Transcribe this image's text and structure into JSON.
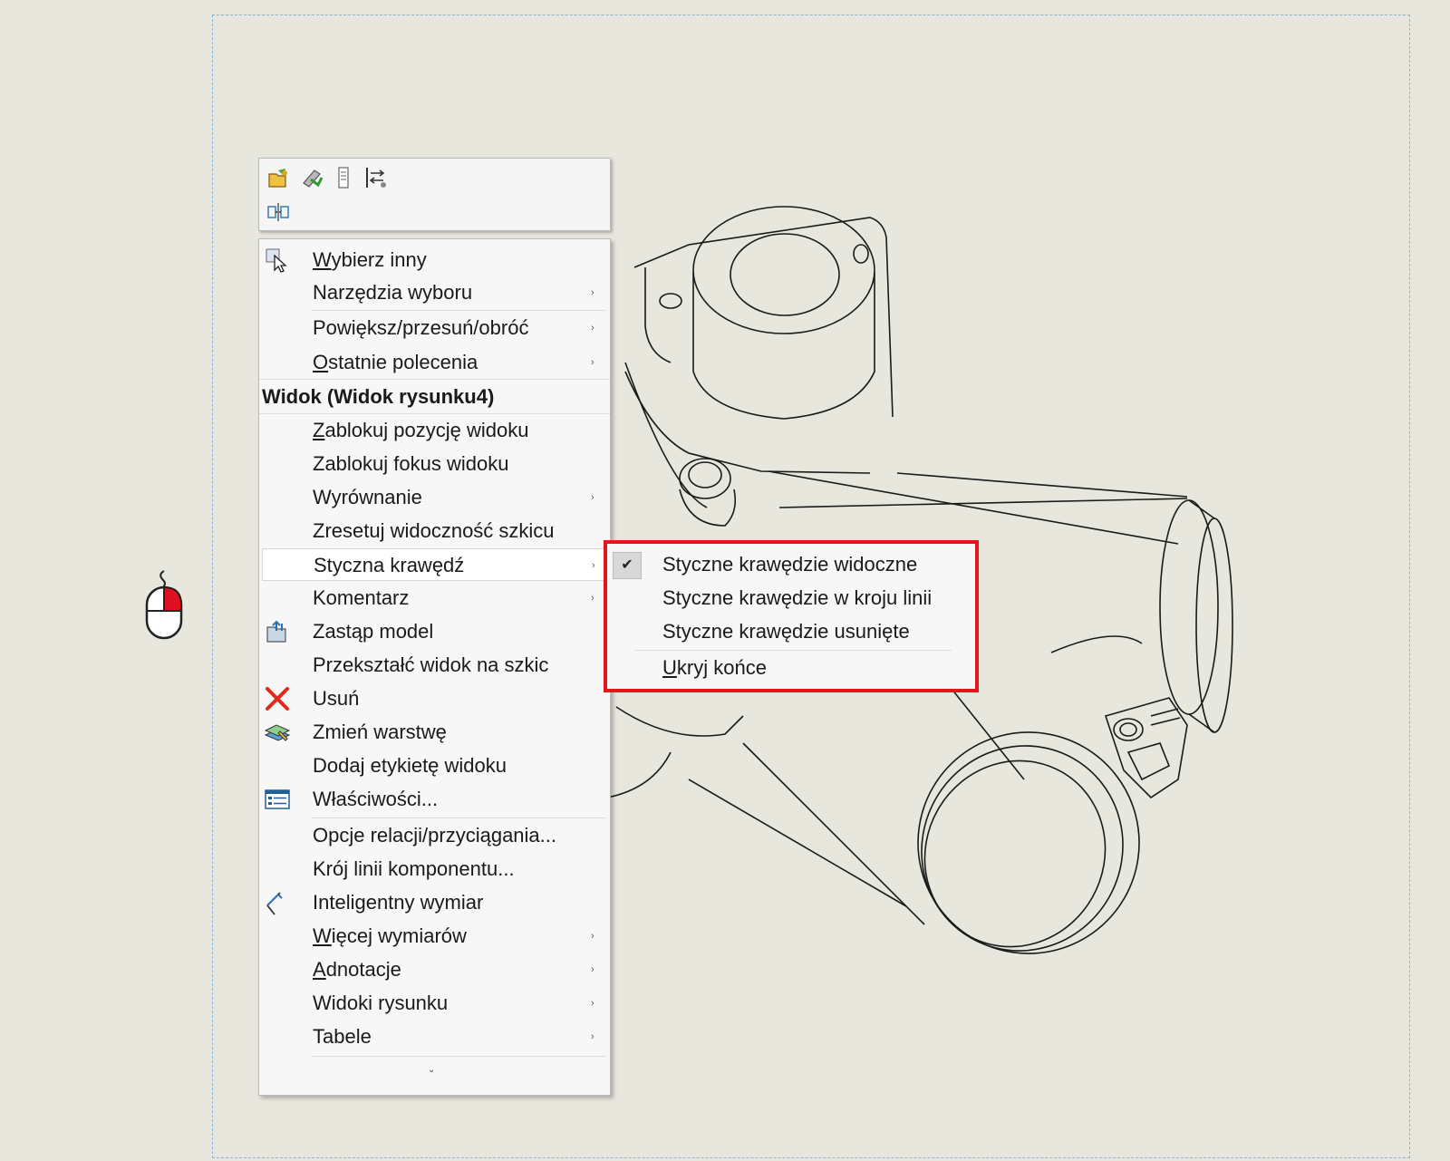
{
  "toolbar": {
    "icons": [
      "open-drawing-icon",
      "rebuild-icon",
      "properties-column-icon",
      "align-view-icon",
      "break-alignment-icon"
    ]
  },
  "menu": {
    "items": [
      {
        "label": "Wybierz inny",
        "accel": "W",
        "icon": "select-other-icon",
        "submenu": false
      },
      {
        "label": "Narzędzia wyboru",
        "submenu": true
      },
      {
        "label": "Powiększ/przesuń/obróć",
        "submenu": true
      },
      {
        "label": "Ostatnie polecenia",
        "accel": "O",
        "submenu": true
      },
      {
        "label": "Widok (Widok rysunku4)",
        "header": true
      },
      {
        "label": "Zablokuj pozycję widoku",
        "accel": "Z",
        "submenu": false
      },
      {
        "label": "Zablokuj fokus widoku",
        "submenu": false
      },
      {
        "label": "Wyrównanie",
        "submenu": true
      },
      {
        "label": "Zresetuj widoczność szkicu",
        "submenu": false
      },
      {
        "label": "Styczna krawędź",
        "submenu": true,
        "active": true
      },
      {
        "label": "Komentarz",
        "submenu": true
      },
      {
        "label": "Zastąp model",
        "icon": "replace-model-icon",
        "submenu": false
      },
      {
        "label": "Przekształć widok na szkic",
        "submenu": false
      },
      {
        "label": "Usuń",
        "icon": "delete-icon",
        "submenu": false
      },
      {
        "label": "Zmień warstwę",
        "icon": "change-layer-icon",
        "submenu": false
      },
      {
        "label": "Dodaj etykietę widoku",
        "submenu": false
      },
      {
        "label": "Właściwości...",
        "icon": "properties-icon",
        "submenu": false
      },
      {
        "label": "Opcje relacji/przyciągania...",
        "submenu": false
      },
      {
        "label": "Krój linii komponentu...",
        "submenu": false
      },
      {
        "label": "Inteligentny wymiar",
        "icon": "smart-dimension-icon",
        "submenu": false
      },
      {
        "label": "Więcej wymiarów",
        "accel": "W",
        "submenu": true
      },
      {
        "label": "Adnotacje",
        "accel": "A",
        "submenu": true
      },
      {
        "label": "Widoki rysunku",
        "submenu": true
      },
      {
        "label": "Tabele",
        "submenu": true
      }
    ],
    "arrow_glyph": "›",
    "more_glyph": "⌄"
  },
  "submenu": {
    "items": [
      {
        "label": "Styczne krawędzie widoczne",
        "checked": true,
        "check_glyph": "✔"
      },
      {
        "label": "Styczne krawędzie w kroju linii",
        "checked": false
      },
      {
        "label": "Styczne krawędzie usunięte",
        "checked": false
      },
      {
        "label": "Ukryj końce",
        "checked": false
      }
    ]
  },
  "colors": {
    "highlight_border": "#e8141c",
    "background": "#e8e7dd",
    "mouse_button": "#e01020"
  }
}
